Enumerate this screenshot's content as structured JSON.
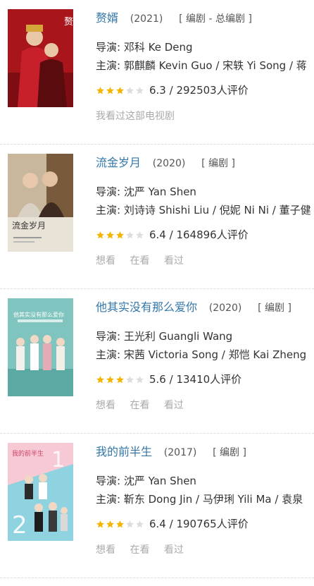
{
  "accent": "#3377aa",
  "star_color": "#f4b400",
  "items": [
    {
      "title": "赘婿",
      "year": "(2021)",
      "role": "[ 编剧 - 总编剧 ]",
      "director_label": "导演:",
      "director": "邓科 Ke Deng",
      "cast_label": "主演:",
      "cast": "郭麒麟 Kevin Guo / 宋轶 Yi Song / 蒋",
      "stars": 3,
      "rating": "6.3 / 292503人评价",
      "actions": [
        "我看过这部电视剧"
      ],
      "poster_text": "赘婿"
    },
    {
      "title": "流金岁月",
      "year": "(2020)",
      "role": "[ 编剧 ]",
      "director_label": "导演:",
      "director": "沈严 Yan Shen",
      "cast_label": "主演:",
      "cast": "刘诗诗 Shishi Liu / 倪妮 Ni Ni / 董子健",
      "stars": 3,
      "rating": "6.4 / 164896人评价",
      "actions": [
        "想看",
        "在看",
        "看过"
      ],
      "poster_text": "流金岁月"
    },
    {
      "title": "他其实没有那么爱你",
      "year": "(2020)",
      "role": "[ 编剧 ]",
      "director_label": "导演:",
      "director": "王光利 Guangli Wang",
      "cast_label": "主演:",
      "cast": "宋茜 Victoria Song / 郑恺 Kai Zheng",
      "stars": 3,
      "rating": "5.6 / 13410人评价",
      "actions": [
        "想看",
        "在看",
        "看过"
      ],
      "poster_text": "他其实没有那么爱你"
    },
    {
      "title": "我的前半生",
      "year": "(2017)",
      "role": "[ 编剧 ]",
      "director_label": "导演:",
      "director": "沈严 Yan Shen",
      "cast_label": "主演:",
      "cast": "靳东 Dong Jin / 马伊琍 Yili Ma / 袁泉",
      "stars": 3,
      "rating": "6.4 / 190765人评价",
      "actions": [
        "想看",
        "在看",
        "看过"
      ],
      "poster_text": "我的前半生"
    }
  ]
}
